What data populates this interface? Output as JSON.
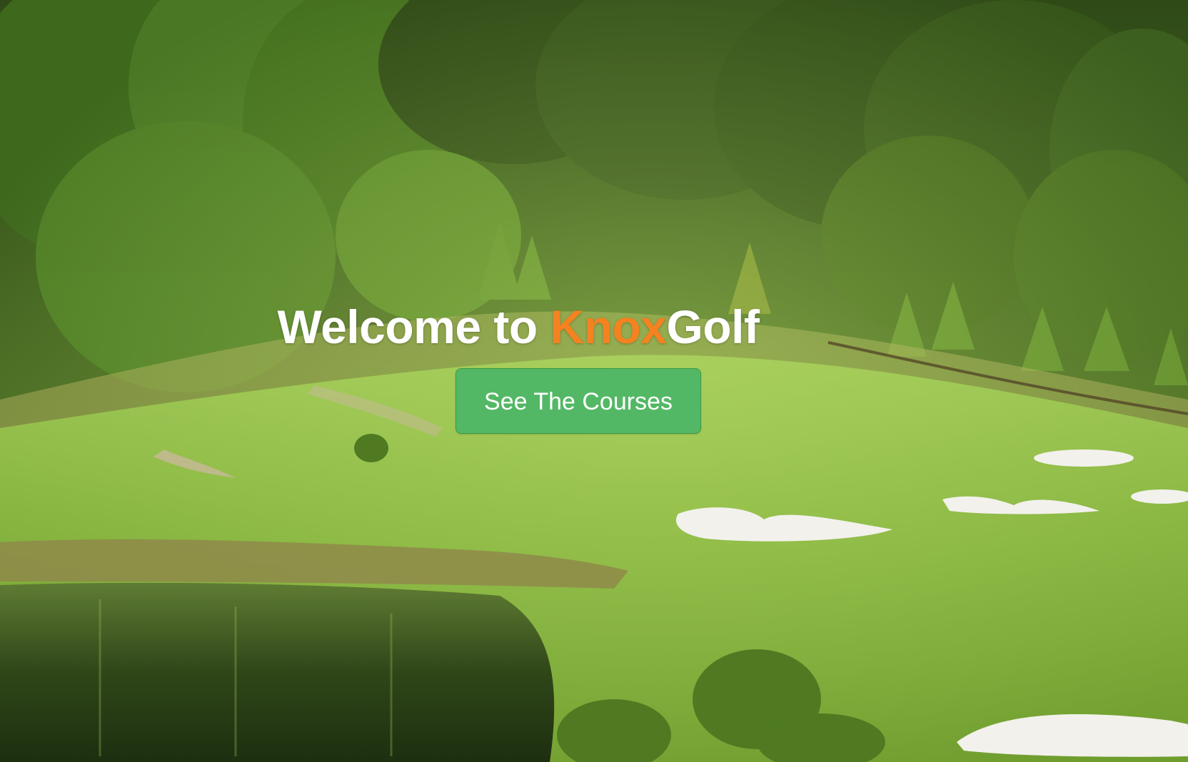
{
  "hero": {
    "headline_prefix": "Welcome to ",
    "brand_accent": "Knox",
    "brand_rest": "Golf",
    "cta_label": "See The Courses"
  },
  "colors": {
    "brand_accent": "#f58220",
    "cta_background": "#53b865",
    "headline_text": "#ffffff"
  },
  "background": {
    "scene": "golf-course-landscape-photo"
  }
}
